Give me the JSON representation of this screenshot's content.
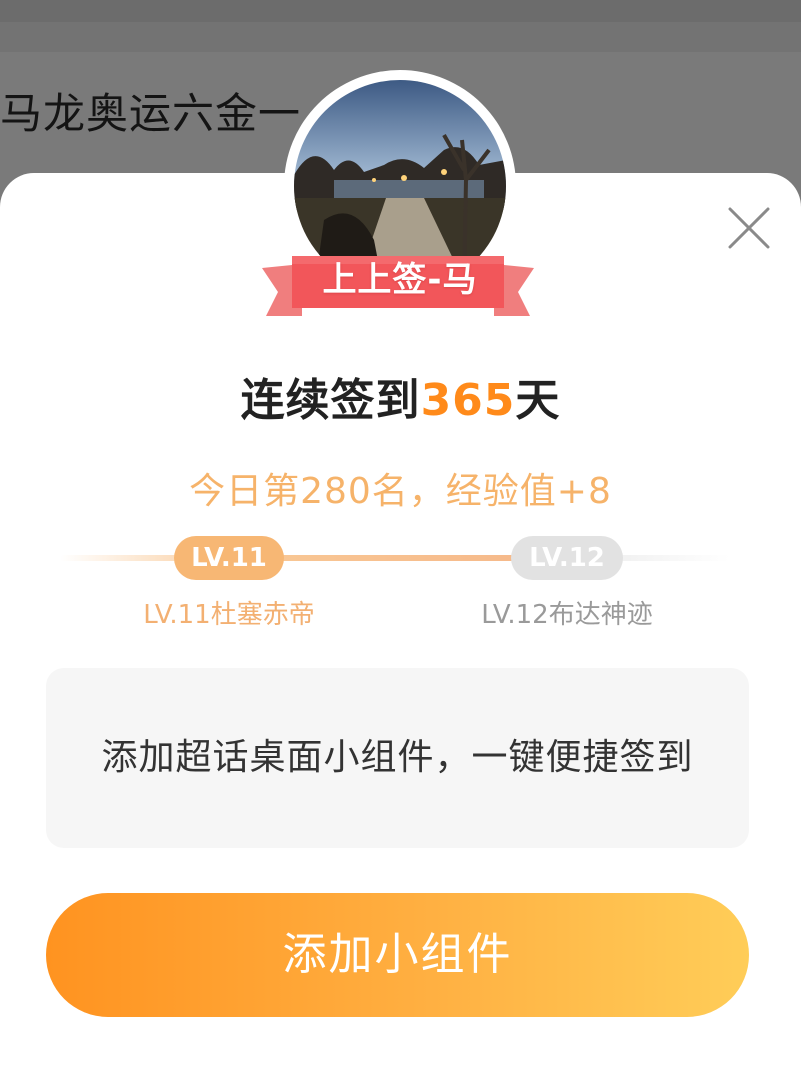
{
  "background": {
    "feed_title": "马龙奥运六金一...",
    "dim_color": "#7a7a7a"
  },
  "dialog": {
    "close_icon": "close-icon",
    "avatar_icon": "avatar-photo",
    "badge_label": "上上签-马",
    "streak": {
      "prefix": "连续签到",
      "days": "365",
      "suffix": "天"
    },
    "rank_text": "今日第280名，经验值+8",
    "level": {
      "current_badge": "LV.11",
      "current_name": "LV.11杜塞赤帝",
      "next_badge": "LV.12",
      "next_name": "LV.12布达神迹",
      "progress": 1.0
    },
    "promo_text": "添加超话桌面小组件，一键便捷签到",
    "cta_label": "添加小组件",
    "colors": {
      "accent": "#ff8a1a",
      "ribbon": "#f2565a",
      "cta_start": "#ff9320",
      "cta_end": "#ffcd58"
    }
  }
}
